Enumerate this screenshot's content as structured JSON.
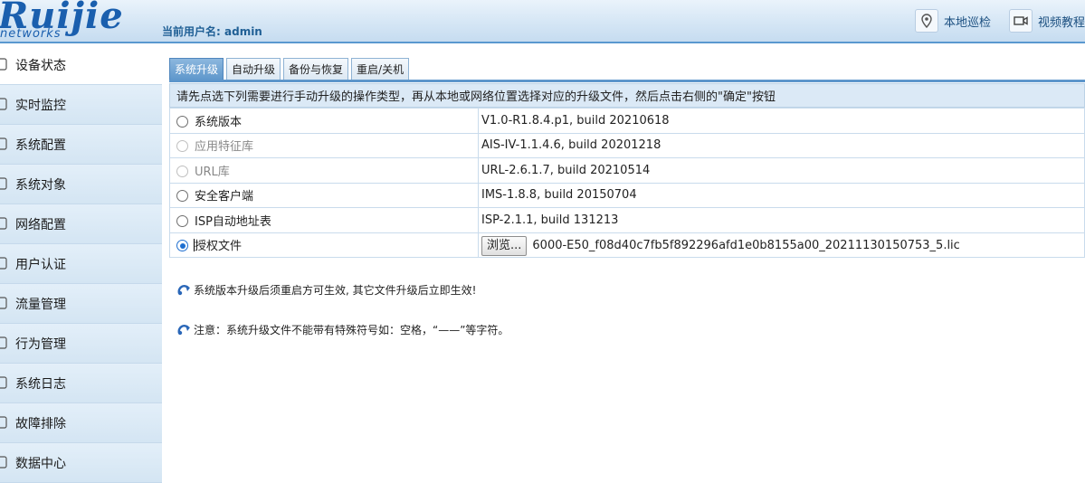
{
  "brand": {
    "logo_text": "Ruijie",
    "logo_sub": "networks"
  },
  "header": {
    "user_label": "当前用户名:",
    "user_name": "admin",
    "patrol_label": "本地巡检",
    "video_label": "视频教程"
  },
  "sidebar": {
    "items": [
      {
        "label": "设备状态",
        "icon": "clipboard-icon",
        "active": true
      },
      {
        "label": "实时监控",
        "icon": "monitor-icon"
      },
      {
        "label": "系统配置",
        "icon": "gear-icon"
      },
      {
        "label": "系统对象",
        "icon": "pencil-icon"
      },
      {
        "label": "网络配置",
        "icon": "network-icon"
      },
      {
        "label": "用户认证",
        "icon": "user-card-icon"
      },
      {
        "label": "流量管理",
        "icon": "traffic-icon"
      },
      {
        "label": "行为管理",
        "icon": "behavior-icon"
      },
      {
        "label": "系统日志",
        "icon": "log-icon"
      },
      {
        "label": "故障排除",
        "icon": "troubleshoot-icon"
      },
      {
        "label": "数据中心",
        "icon": "database-icon"
      }
    ]
  },
  "tabs": [
    {
      "label": "系统升级",
      "active": true
    },
    {
      "label": "自动升级"
    },
    {
      "label": "备份与恢复"
    },
    {
      "label": "重启/关机"
    }
  ],
  "instruction": "请先点选下列需要进行手动升级的操作类型，再从本地或网络位置选择对应的升级文件，然后点击右侧的\"确定\"按钮",
  "upgrade_rows": [
    {
      "label": "系统版本",
      "value": "V1.0-R1.8.4.p1, build 20210618",
      "state": "enabled"
    },
    {
      "label": "应用特征库",
      "value": "AIS-IV-1.1.4.6, build 20201218",
      "state": "disabled"
    },
    {
      "label": "URL库",
      "value": "URL-2.6.1.7, build 20210514",
      "state": "disabled"
    },
    {
      "label": "安全客户端",
      "value": "IMS-1.8.8, build 20150704",
      "state": "enabled"
    },
    {
      "label": "ISP自动地址表",
      "value": "ISP-2.1.1, build 131213",
      "state": "enabled"
    },
    {
      "label": "授权文件",
      "state": "checked",
      "browse_label": "浏览...",
      "file_name": "6000-E50_f08d40c7fb5f892296afd1e0b8155a00_20211130150753_5.lic"
    }
  ],
  "notes": [
    "系统版本升级后须重启方可生效, 其它文件升级后立即生效!",
    "注意：系统升级文件不能带有特殊符号如：空格，“——”等字符。"
  ],
  "colors": {
    "accent": "#5d96cb",
    "active_tab": "#6fa4d4",
    "sidebar": "#dbeaf6",
    "radio_checked": "#1f6fd0"
  }
}
